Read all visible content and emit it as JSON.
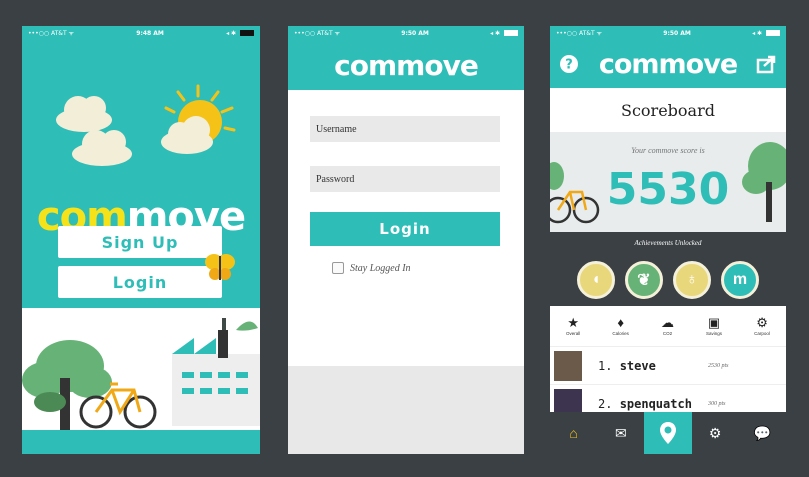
{
  "status": {
    "carrier": "•••○○ AT&T ᯤ",
    "time_p1": "9:48 AM",
    "time_p2": "9:50 AM",
    "time_p3": "9:50 AM"
  },
  "brand": {
    "logo_a": "com",
    "logo_b": "move",
    "primary": "#2fbdb7",
    "accent": "#f5e21b"
  },
  "welcome": {
    "signup_label": "Sign Up",
    "login_label": "Login"
  },
  "login": {
    "username_placeholder": "Username",
    "password_placeholder": "Password",
    "login_label": "Login",
    "stay_logged_in_label": "Stay Logged In"
  },
  "scoreboard": {
    "title": "Scoreboard",
    "subtitle": "Your commove score is",
    "score": "5530",
    "achievements_label": "Achievements Unlocked",
    "badges": [
      "duck-icon",
      "leaf-icon",
      "drink-icon",
      "m-icon"
    ],
    "stats": [
      {
        "icon": "star-icon",
        "label": "Overall"
      },
      {
        "icon": "flame-icon",
        "label": "Calories"
      },
      {
        "icon": "cloud-icon",
        "label": "CO2"
      },
      {
        "icon": "money-icon",
        "label": "Savings"
      },
      {
        "icon": "gear-icon",
        "label": "Carpool"
      }
    ],
    "leaderboard": [
      {
        "rank": "1.",
        "name": "steve",
        "points": "2530 pts"
      },
      {
        "rank": "2.",
        "name": "spenquatch",
        "points": "300 pts"
      }
    ],
    "tabs": [
      "home-icon",
      "mail-icon",
      "location-pin-icon",
      "gear-icon",
      "chat-icon"
    ]
  }
}
